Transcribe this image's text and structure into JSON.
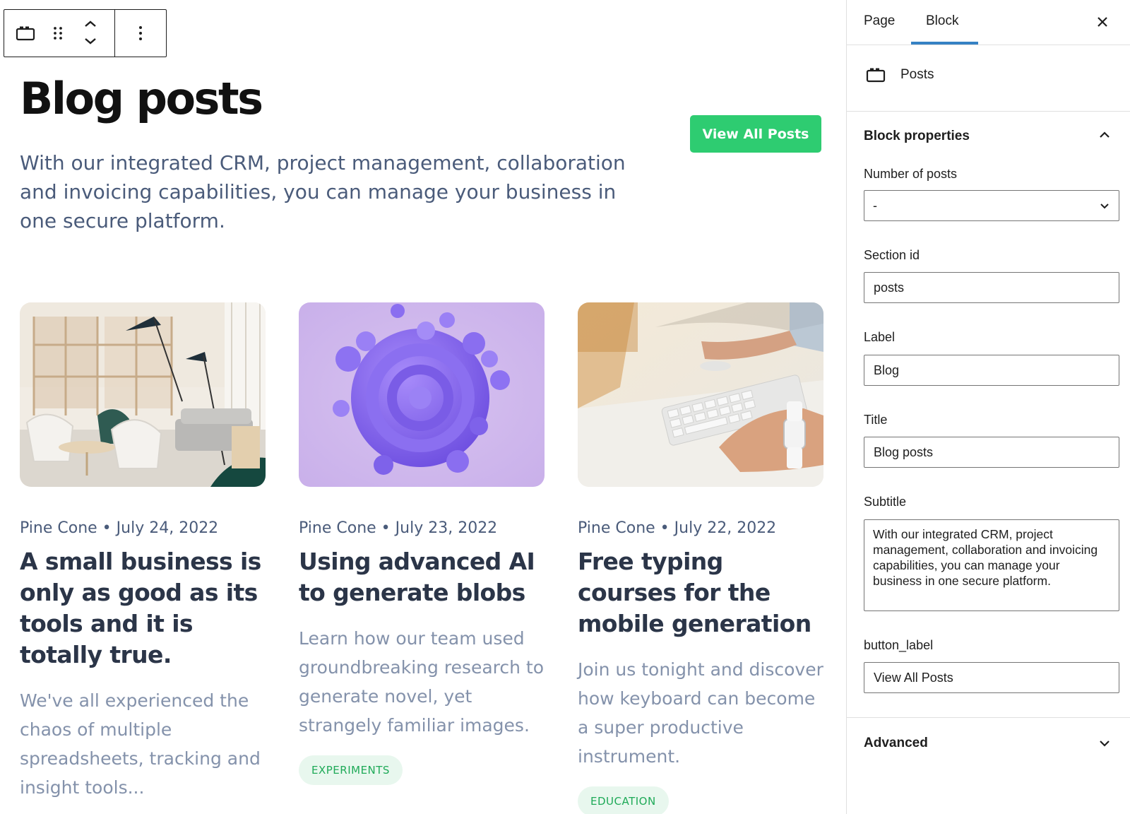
{
  "editor": {
    "heading": "Blog posts",
    "intro": "With our integrated CRM, project management, collaboration and invoicing capabilities, you can manage your business in one secure platform.",
    "view_all_label": "View All Posts",
    "posts": [
      {
        "author": "Pine Cone",
        "date": "July 24, 2022",
        "title": "A small business is only as good as its tools and it is totally true.",
        "excerpt": "We've all experienced the chaos of multiple spreadsheets, tracking and insight tools...",
        "tag": ""
      },
      {
        "author": "Pine Cone",
        "date": "July 23, 2022",
        "title": "Using advanced AI to generate blobs",
        "excerpt": "Learn how our team used groundbreaking research to generate novel, yet strangely familiar images.",
        "tag": "EXPERIMENTS"
      },
      {
        "author": "Pine Cone",
        "date": "July 22, 2022",
        "title": "Free typing courses for the mobile generation",
        "excerpt": "Join us tonight and discover how keyboard can become a super productive instrument.",
        "tag": "EDUCATION"
      }
    ],
    "meta_separator": "•"
  },
  "sidebar": {
    "tabs": {
      "page": "Page",
      "block": "Block",
      "active": "Block"
    },
    "block_name": "Posts",
    "block_properties_title": "Block properties",
    "fields": {
      "number_of_posts": {
        "label": "Number of posts",
        "value": "-"
      },
      "section_id": {
        "label": "Section id",
        "value": "posts"
      },
      "label": {
        "label": "Label",
        "value": "Blog"
      },
      "title": {
        "label": "Title",
        "value": "Blog posts"
      },
      "subtitle": {
        "label": "Subtitle",
        "value": "With our integrated CRM, project management, collaboration and invoicing capabilities, you can manage your business in one secure platform."
      },
      "button_label": {
        "label": "button_label",
        "value": "View All Posts"
      }
    },
    "advanced_title": "Advanced"
  },
  "colors": {
    "accent_green": "#2ecc71",
    "tab_underline": "#3582c4",
    "tag_text": "#1faa58",
    "tag_bg": "#e8f7ee",
    "text_slate": "#4a5b7a"
  },
  "icons": {
    "block_type": "posts-block-icon",
    "drag": "drag-handle-icon",
    "move": "move-up-down-icon",
    "more": "more-options-icon",
    "close": "close-icon",
    "collapse": "chevron-up-icon",
    "expand": "chevron-down-icon"
  }
}
